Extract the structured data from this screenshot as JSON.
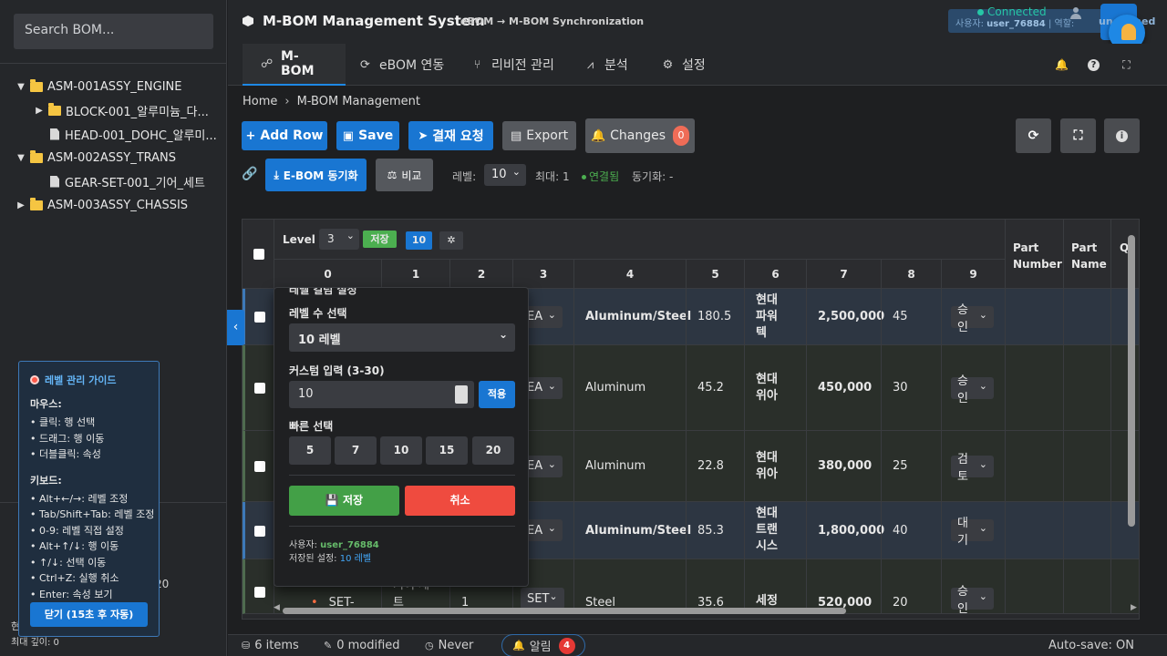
{
  "sidebar": {
    "search_placeholder": "Search BOM...",
    "tree": [
      {
        "label": "ASM-001ASSY_ENGINE",
        "caret": "▼",
        "type": "folder",
        "indent": 0
      },
      {
        "label": "BLOCK-001_알루미늄_다...",
        "caret": "▶",
        "type": "folder",
        "indent": 1
      },
      {
        "label": "HEAD-001_DOHC_알루미...",
        "caret": "",
        "type": "file",
        "indent": 1
      },
      {
        "label": "ASM-002ASSY_TRANS",
        "caret": "▼",
        "type": "folder",
        "indent": 0
      },
      {
        "label": "GEAR-SET-001_기어_세트",
        "caret": "",
        "type": "file",
        "indent": 1
      },
      {
        "label": "ASM-003ASSY_CHASSIS",
        "caret": "▶",
        "type": "folder",
        "indent": 0
      }
    ],
    "partial_value": "20",
    "partial_label_bottom": "최대 깊이: 0",
    "partial_label_mid": "현"
  },
  "guide": {
    "title": "레벨 관리 가이드",
    "mouse_title": "마우스:",
    "mouse_items": [
      "• 클릭: 행 선택",
      "• 드래그: 행 이동",
      "• 더블클릭: 속성"
    ],
    "keyboard_title": "키보드:",
    "keyboard_items": [
      "• Alt+←/→: 레벨 조정",
      "• Tab/Shift+Tab: 레벨 조정",
      "• 0-9: 레벨 직접 설정",
      "• Alt+↑/↓: 행 이동",
      "• ↑/↓: 선택 이동",
      "• Ctrl+Z: 실행 취소",
      "• Enter: 속성 보기"
    ],
    "close_label": "닫기 (15초 후 자동)"
  },
  "header": {
    "title": "M-BOM Management System",
    "subtitle": "eBOM → M-BOM Synchronization",
    "connected": "Connected",
    "user_label": "사용자:",
    "user_name": "user_76884",
    "sep": "|",
    "role_label": "역할:",
    "role_value": "undefined"
  },
  "tabs": [
    {
      "label": "M-BOM",
      "icon": "☍"
    },
    {
      "label": "eBOM 연동",
      "icon": "⟳"
    },
    {
      "label": "리비전 관리",
      "icon": "⑂"
    },
    {
      "label": "분석",
      "icon": "⩘"
    },
    {
      "label": "설정",
      "icon": "⚙"
    }
  ],
  "breadcrumb": {
    "home": "Home",
    "current": "M-BOM Management"
  },
  "toolbar": {
    "add_row": "Add Row",
    "save": "Save",
    "approval": "결재 요청",
    "export": "Export",
    "changes": "Changes",
    "changes_count": "0"
  },
  "sync": {
    "ebom_sync": "E-BOM 동기화",
    "compare": "비교",
    "level_label": "레벨:",
    "level_value": "10",
    "max_label": "최대: 1",
    "connected": "연결됨",
    "sync_label": "동기화: -"
  },
  "grid": {
    "level_label": "Level",
    "level_value": "3",
    "save_mini": "저장",
    "level_count": "10",
    "col_numbers": [
      "0",
      "1",
      "2",
      "3",
      "4",
      "5",
      "6",
      "7",
      "8",
      "9"
    ],
    "extra_cols": [
      "Part Number",
      "Part Name",
      "Q"
    ],
    "rows": [
      {
        "unit": "EA",
        "material": "Aluminum/Steel",
        "weight": "180.5",
        "supplier": "현대파워텍",
        "cost": "2,500,000",
        "lead": "45",
        "status": "승인",
        "selected": true
      },
      {
        "unit": "EA",
        "material": "Aluminum",
        "weight": "45.2",
        "supplier": "현대위아",
        "cost": "450,000",
        "lead": "30",
        "status": "승인",
        "selected": false
      },
      {
        "unit": "EA",
        "material": "Aluminum",
        "weight": "22.8",
        "supplier": "현대위아",
        "cost": "380,000",
        "lead": "25",
        "status": "검토",
        "selected": false
      },
      {
        "unit": "EA",
        "material": "Aluminum/Steel",
        "weight": "85.3",
        "supplier": "현대트랜시스",
        "cost": "1,800,000",
        "lead": "40",
        "status": "대기",
        "selected": true
      },
      {
        "unit": "SET",
        "material": "Steel",
        "weight": "35.6",
        "supplier": "세정",
        "cost": "520,000",
        "lead": "20",
        "status": "승인",
        "selected": false,
        "code": "SET-",
        "name": "기어 세트",
        "qty": "1"
      }
    ]
  },
  "popup": {
    "title": "레벨 컬럼 설정",
    "count_label": "레벨 수 선택",
    "count_value": "10 레벨",
    "custom_label": "커스텀 입력 (3-30)",
    "custom_value": "10",
    "apply": "적용",
    "quick_label": "빠른 선택",
    "quick": [
      "5",
      "7",
      "10",
      "15",
      "20"
    ],
    "save": "저장",
    "cancel": "취소",
    "user_label": "사용자:",
    "user_value": "user_76884",
    "saved_label": "저장된 설정:",
    "saved_value": "10 레벨"
  },
  "status": {
    "items": "6 items",
    "modified": "0 modified",
    "never": "Never",
    "alert_label": "알림",
    "alert_count": "4",
    "autosave": "Auto-save: ON"
  }
}
